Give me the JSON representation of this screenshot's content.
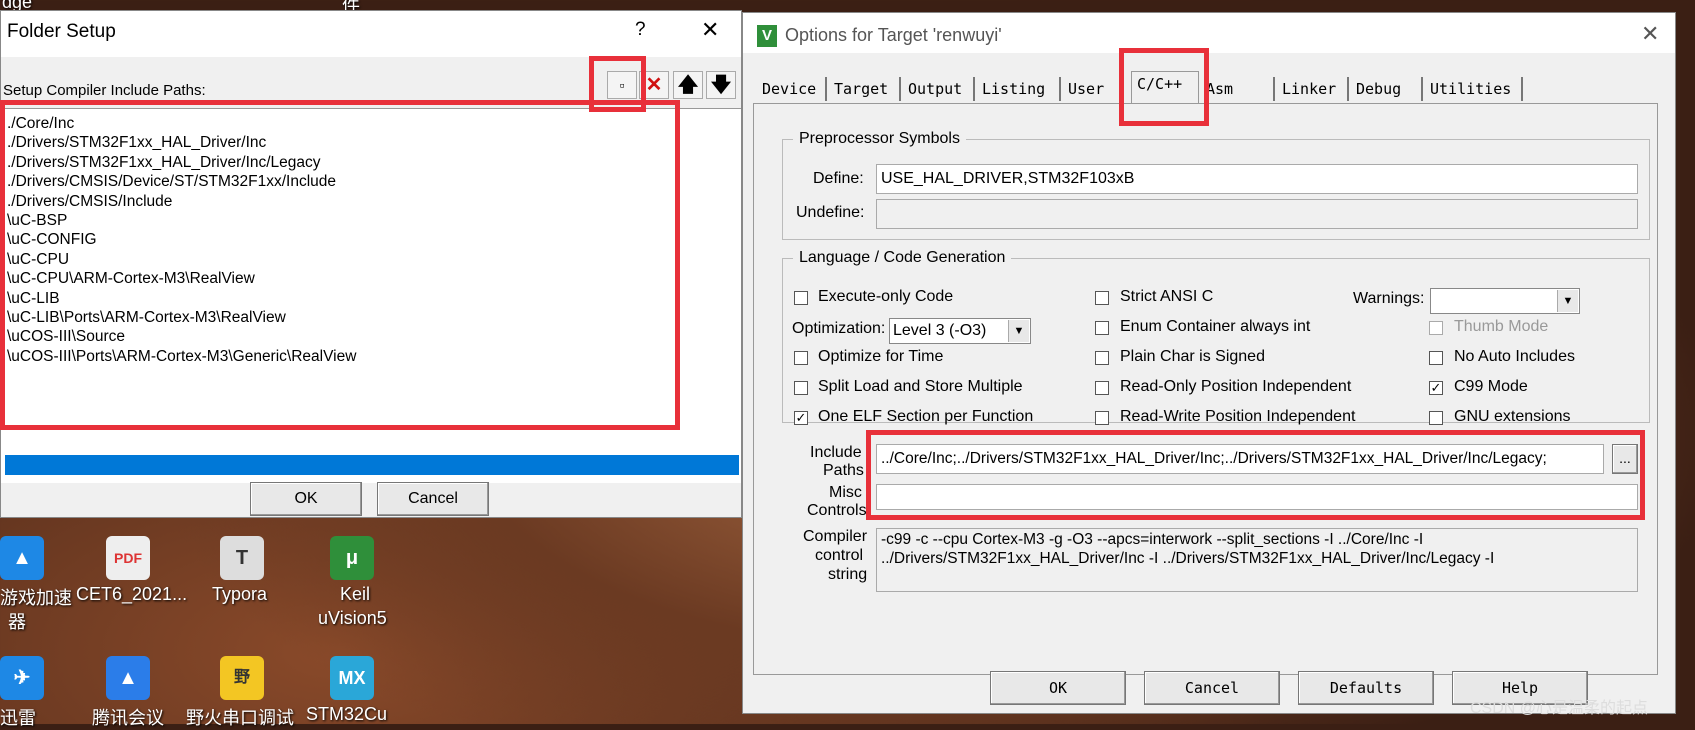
{
  "folder_dialog": {
    "title": "Folder Setup",
    "help_label": "?",
    "close_label": "✕",
    "header_label": "Setup Compiler Include Paths:",
    "paths": [
      "./Core/Inc",
      "./Drivers/STM32F1xx_HAL_Driver/Inc",
      "./Drivers/STM32F1xx_HAL_Driver/Inc/Legacy",
      "./Drivers/CMSIS/Device/ST/STM32F1xx/Include",
      "./Drivers/CMSIS/Include",
      "\\uC-BSP",
      "\\uC-CONFIG",
      "\\uC-CPU",
      "\\uC-CPU\\ARM-Cortex-M3\\RealView",
      "\\uC-LIB",
      "\\uC-LIB\\Ports\\ARM-Cortex-M3\\RealView",
      "\\uCOS-III\\Source",
      "\\uCOS-III\\Ports\\ARM-Cortex-M3\\Generic\\RealView"
    ],
    "ok_label": "OK",
    "cancel_label": "Cancel"
  },
  "options_dialog": {
    "title": "Options for Target 'renwuyi'",
    "app_icon_letter": "V",
    "close_label": "✕",
    "tabs": [
      "Device",
      "Target",
      "Output",
      "Listing",
      "User",
      "C/C++",
      "Asm",
      "Linker",
      "Debug",
      "Utilities"
    ],
    "active_tab": "C/C++",
    "preprocessor": {
      "legend": "Preprocessor Symbols",
      "define_label": "Define:",
      "define_value": "USE_HAL_DRIVER,STM32F103xB",
      "undefine_label": "Undefine:",
      "undefine_value": ""
    },
    "language": {
      "legend": "Language / Code Generation",
      "execute_only": "Execute-only Code",
      "optimization_label": "Optimization:",
      "optimization_value": "Level 3 (-O3)",
      "optimize_time": "Optimize for Time",
      "split_load": "Split Load and Store Multiple",
      "one_elf": "One ELF Section per Function",
      "strict_ansi": "Strict ANSI C",
      "enum_container": "Enum Container always int",
      "plain_char": "Plain Char is Signed",
      "ro_pi": "Read-Only Position Independent",
      "rw_pi": "Read-Write Position Independent",
      "warnings_label": "Warnings:",
      "warnings_value": "",
      "thumb_mode": "Thumb Mode",
      "no_auto_includes": "No Auto Includes",
      "c99_mode": "C99 Mode",
      "gnu_ext": "GNU extensions"
    },
    "include_paths_label_1": "Include",
    "include_paths_label_2": "Paths",
    "include_paths_value": "../Core/Inc;../Drivers/STM32F1xx_HAL_Driver/Inc;../Drivers/STM32F1xx_HAL_Driver/Inc/Legacy;",
    "browse_label": "...",
    "misc_label_1": "Misc",
    "misc_label_2": "Controls",
    "misc_value": "",
    "compiler_label_1": "Compiler",
    "compiler_label_2": "control",
    "compiler_label_3": "string",
    "compiler_line_1": "-c99 -c --cpu Cortex-M3 -g -O3 --apcs=interwork --split_sections -I ../Core/Inc -I",
    "compiler_line_2": "../Drivers/STM32F1xx_HAL_Driver/Inc -I ../Drivers/STM32F1xx_HAL_Driver/Inc/Legacy -I",
    "ok_label": "OK",
    "cancel_label": "Cancel",
    "defaults_label": "Defaults",
    "help_label": "Help"
  },
  "desktop": {
    "top_label_1": "dge",
    "top_label_2": "件",
    "icons": [
      {
        "label_1": "游戏加速",
        "label_2": "器"
      },
      {
        "label_1": "CET6_2021...",
        "label_2": ""
      },
      {
        "label_1": "Typora",
        "label_2": ""
      },
      {
        "label_1": "Keil",
        "label_2": "uVision5"
      },
      {
        "label_1": "迅雷",
        "label_2": ""
      },
      {
        "label_1": "腾讯会议",
        "label_2": ""
      },
      {
        "label_1": "野火串口调试",
        "label_2": ""
      },
      {
        "label_1": "STM32Cu",
        "label_2": ""
      }
    ],
    "watermark": "CSDN @心是温柔的起点"
  },
  "colors": {
    "highlight_red": "#e8303a",
    "selection_blue": "#0078d7",
    "keil_green": "#2f8f3a"
  }
}
